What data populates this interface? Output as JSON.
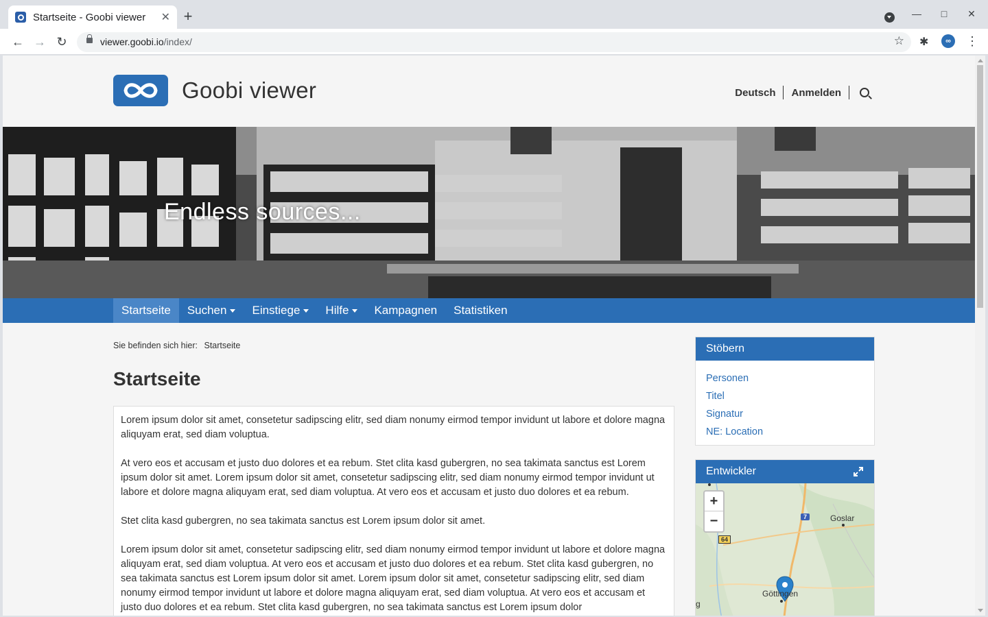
{
  "browser": {
    "tab_title": "Startseite - Goobi viewer",
    "url_host": "viewer.goobi.io",
    "url_path": "/index/"
  },
  "site": {
    "title": "Goobi viewer",
    "brand_color": "#2b6eb5",
    "top_nav": {
      "language": "Deutsch",
      "login": "Anmelden"
    }
  },
  "hero": {
    "caption": "Endless sources..."
  },
  "main_nav": [
    {
      "label": "Startseite",
      "active": true,
      "dropdown": false
    },
    {
      "label": "Suchen",
      "active": false,
      "dropdown": true
    },
    {
      "label": "Einstiege",
      "active": false,
      "dropdown": true
    },
    {
      "label": "Hilfe",
      "active": false,
      "dropdown": true
    },
    {
      "label": "Kampagnen",
      "active": false,
      "dropdown": false
    },
    {
      "label": "Statistiken",
      "active": false,
      "dropdown": false
    }
  ],
  "breadcrumb": {
    "prefix": "Sie befinden sich hier:",
    "current": "Startseite"
  },
  "page": {
    "title": "Startseite",
    "paragraphs": [
      "Lorem ipsum dolor sit amet, consetetur sadipscing elitr, sed diam nonumy eirmod tempor invidunt ut labore et dolore magna aliquyam erat, sed diam voluptua.",
      "At vero eos et accusam et justo duo dolores et ea rebum. Stet clita kasd gubergren, no sea takimata sanctus est Lorem ipsum dolor sit amet. Lorem ipsum dolor sit amet, consetetur sadipscing elitr, sed diam nonumy eirmod tempor invidunt ut labore et dolore magna aliquyam erat, sed diam voluptua. At vero eos et accusam et justo duo dolores et ea rebum.",
      "Stet clita kasd gubergren, no sea takimata sanctus est Lorem ipsum dolor sit amet.",
      "Lorem ipsum dolor sit amet, consetetur sadipscing elitr, sed diam nonumy eirmod tempor invidunt ut labore et dolore magna aliquyam erat, sed diam voluptua. At vero eos et accusam et justo duo dolores et ea rebum. Stet clita kasd gubergren, no sea takimata sanctus est Lorem ipsum dolor sit amet. Lorem ipsum dolor sit amet, consetetur sadipscing elitr, sed diam nonumy eirmod tempor invidunt ut labore et dolore magna aliquyam erat, sed diam voluptua. At vero eos et accusam et justo duo dolores et ea rebum. Stet clita kasd gubergren, no sea takimata sanctus est Lorem ipsum dolor"
    ]
  },
  "sidebar": {
    "browse": {
      "title": "Stöbern",
      "links": [
        "Personen",
        "Titel",
        "Signatur",
        "NE: Location"
      ]
    },
    "developer": {
      "title": "Entwickler",
      "map": {
        "zoom_in": "+",
        "zoom_out": "−",
        "labels": {
          "goslar": "Goslar",
          "goettingen": "Göttingen",
          "edge": "g"
        },
        "road_shields": {
          "a7": "7",
          "b64": "64"
        }
      }
    }
  }
}
